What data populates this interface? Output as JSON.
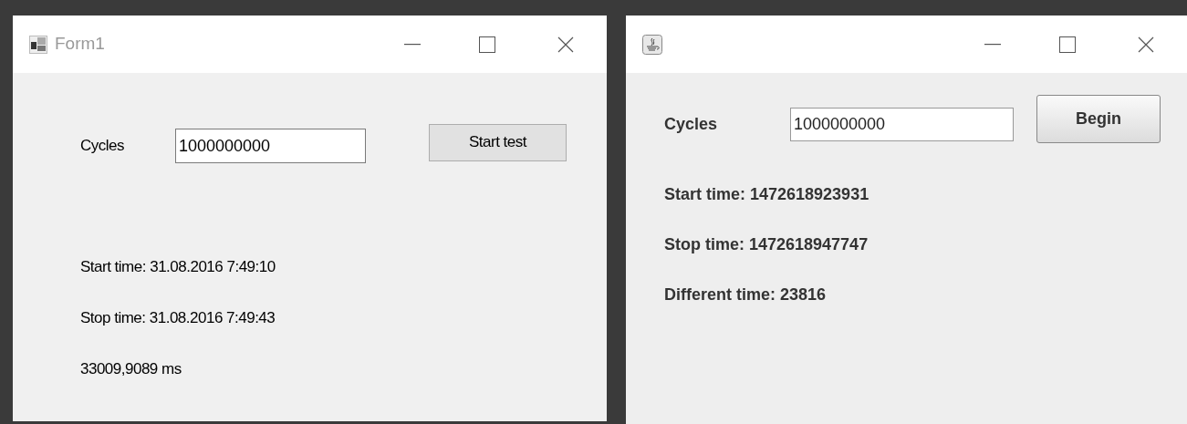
{
  "windows": [
    {
      "kind": "winforms",
      "title": "Form1",
      "cycles_label": "Cycles",
      "cycles_value": "1000000000",
      "button": "Start test",
      "lines": [
        "Start time: 31.08.2016 7:49:10",
        "Stop time: 31.08.2016 7:49:43",
        "33009,9089 ms"
      ]
    },
    {
      "kind": "swing",
      "cycles_label": "Cycles",
      "cycles_value": "1000000000",
      "button": "Begin",
      "lines": [
        "Start time: 1472618923931",
        "Stop time: 1472618947747",
        "Different time: 23816"
      ]
    }
  ]
}
